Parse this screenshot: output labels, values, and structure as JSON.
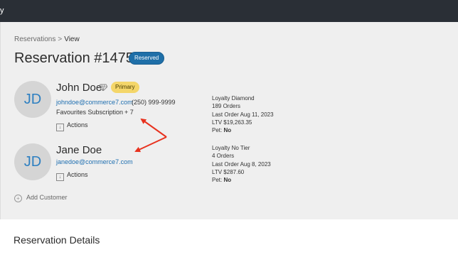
{
  "topbar": {
    "title": "y"
  },
  "breadcrumb": {
    "parent": "Reservations",
    "separator": ">",
    "current": "View"
  },
  "reservation": {
    "title": "Reservation #1475",
    "status": "Reserved",
    "status_color": "#1f6fa8"
  },
  "customers": [
    {
      "initials": "JD",
      "name": "John Doe",
      "badge": "Primary",
      "email": "johndoe@commerce7.com",
      "phone": "(250) 999-9999",
      "subscription": "Favourites Subscription",
      "subscription_more": "+ 7",
      "actions_label": "Actions",
      "loyalty": "Loyalty Diamond",
      "orders": "189 Orders",
      "last_order": "Last Order Aug 11, 2023",
      "ltv": "LTV $19,263.35",
      "pet_label": "Pet:",
      "pet_value": "No"
    },
    {
      "initials": "JD",
      "name": "Jane Doe",
      "email": "janedoe@commerce7.com",
      "actions_label": "Actions",
      "loyalty": "Loyalty No Tier",
      "orders": "4 Orders",
      "last_order": "Last Order Aug 8, 2023",
      "ltv": "LTV $287.60",
      "pet_label": "Pet:",
      "pet_value": "No"
    }
  ],
  "add_customer": "Add Customer",
  "details": {
    "title": "Reservation Details"
  },
  "annotation": {
    "arrow_color": "#e8321e"
  }
}
